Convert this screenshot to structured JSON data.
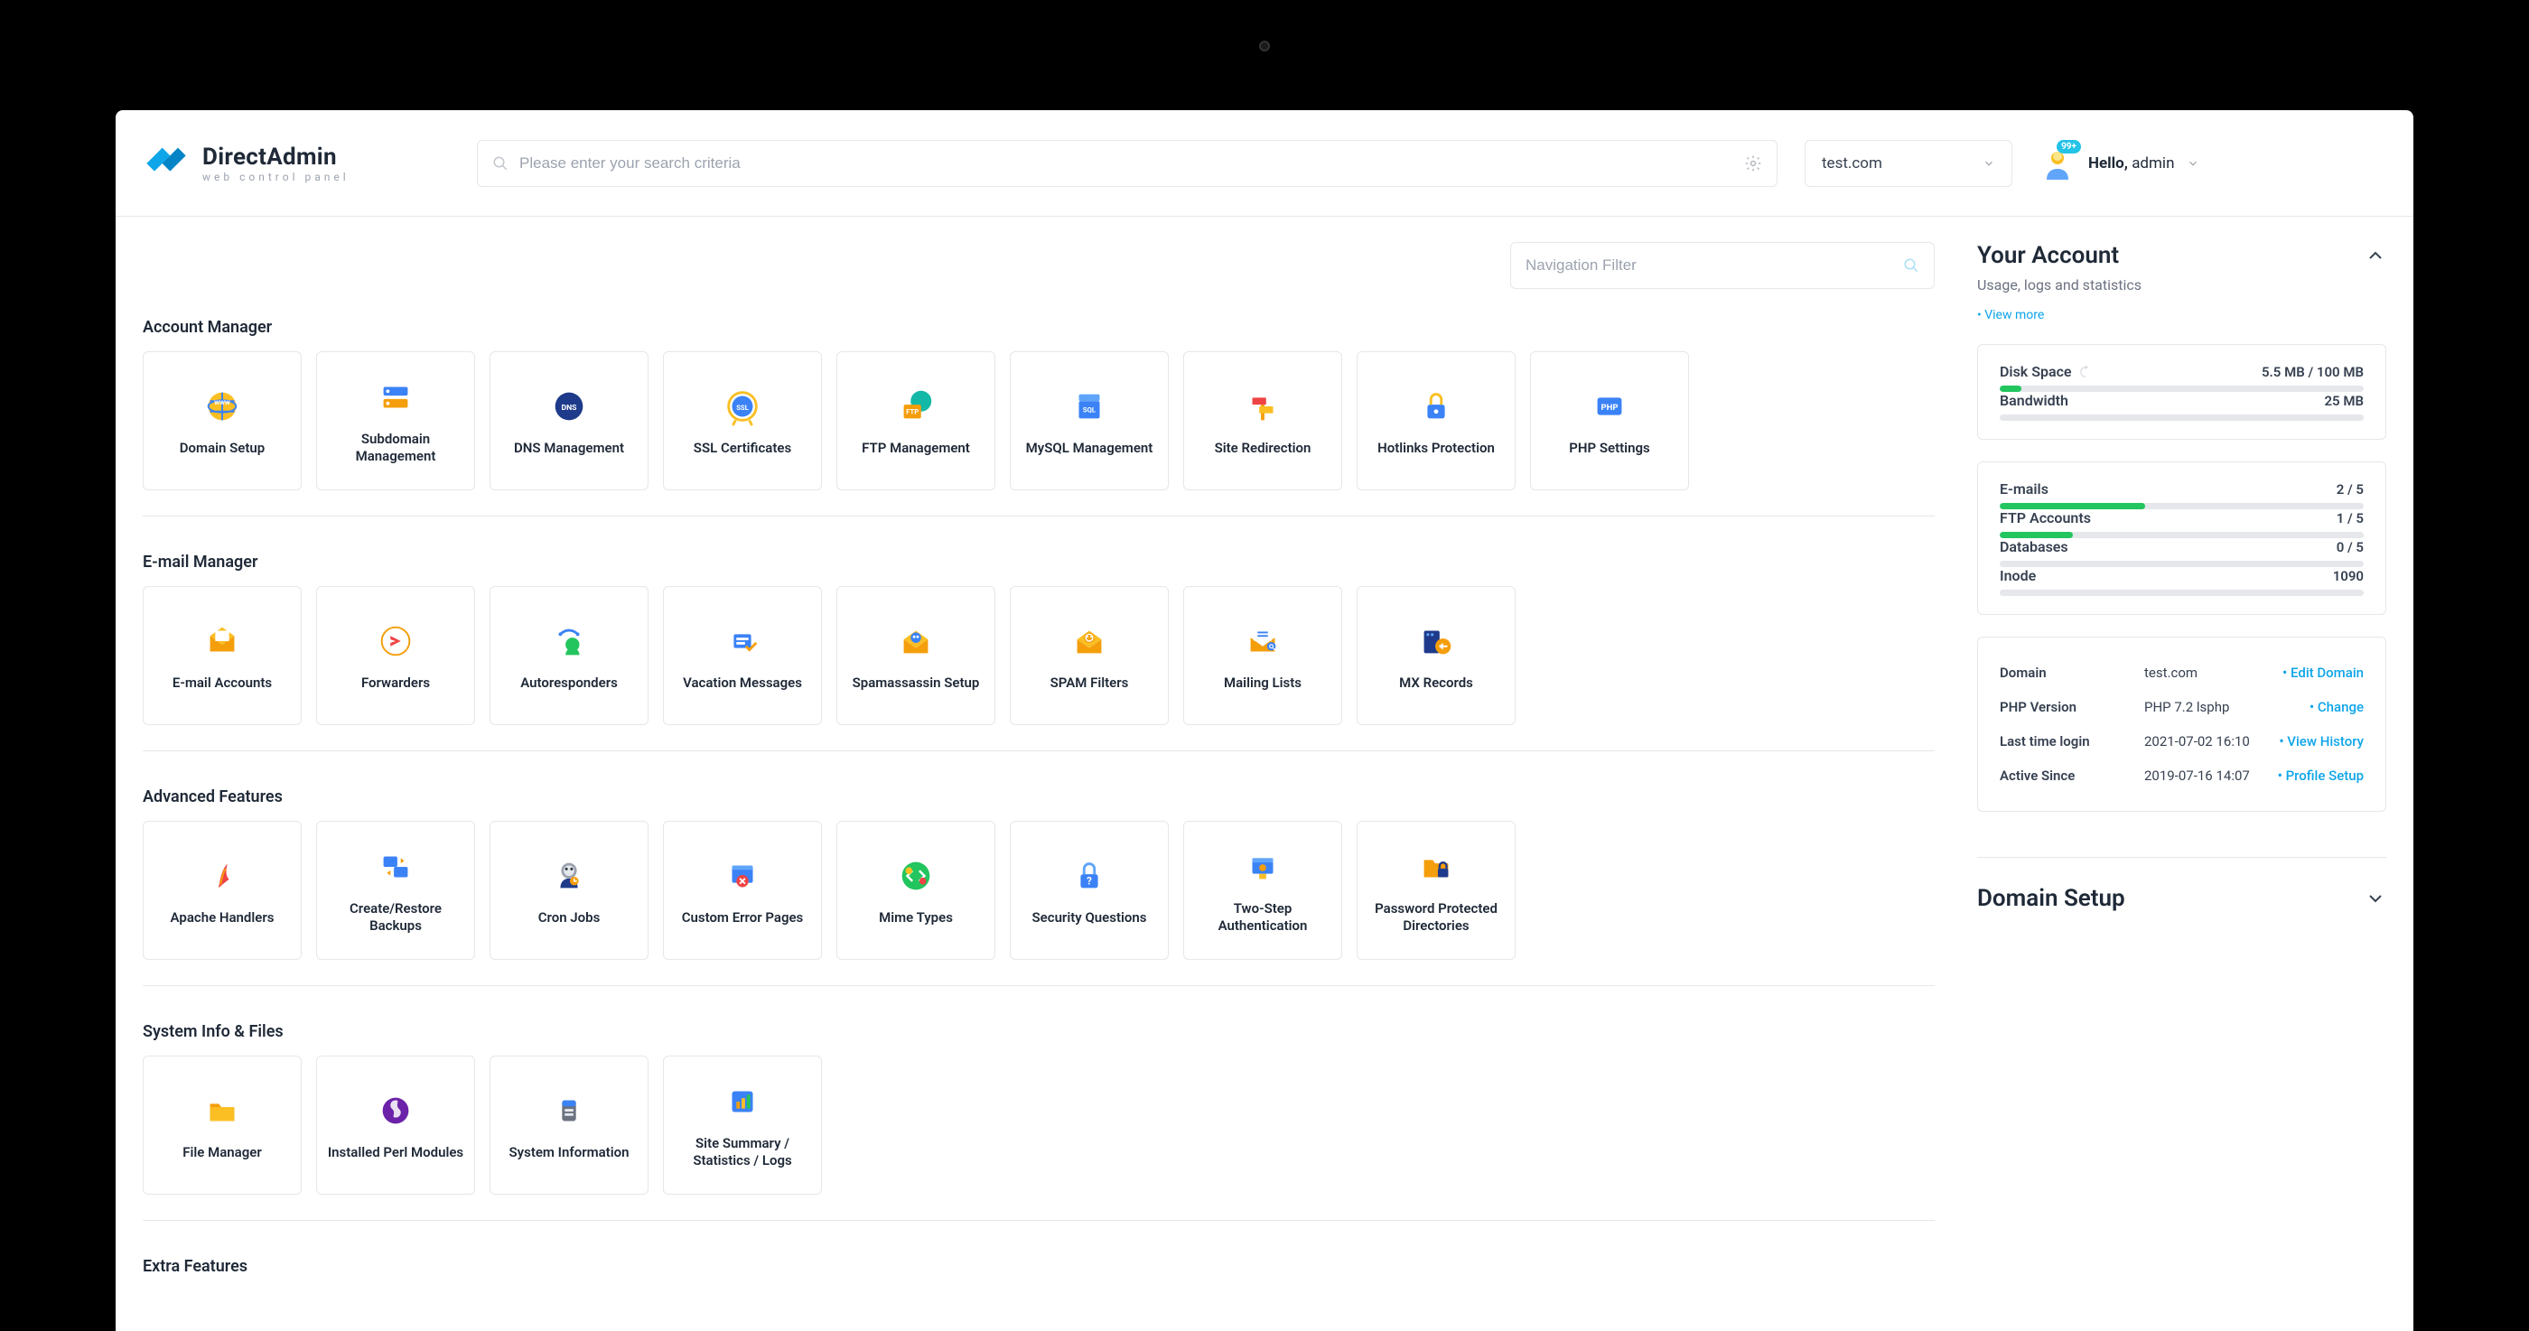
{
  "logo": {
    "title": "DirectAdmin",
    "subtitle": "web control panel"
  },
  "search": {
    "placeholder": "Please enter your search criteria"
  },
  "domain_dropdown": "test.com",
  "user": {
    "hello": "Hello,",
    "name": "admin",
    "badge": "99+"
  },
  "nav_filter": {
    "placeholder": "Navigation Filter"
  },
  "sections": [
    {
      "title": "Account Manager",
      "items": [
        {
          "icon": "globe",
          "label": "Domain Setup"
        },
        {
          "icon": "subdomain",
          "label": "Subdomain Management"
        },
        {
          "icon": "dns",
          "label": "DNS Management"
        },
        {
          "icon": "ssl",
          "label": "SSL Certificates"
        },
        {
          "icon": "ftp",
          "label": "FTP Management"
        },
        {
          "icon": "mysql",
          "label": "MySQL Management"
        },
        {
          "icon": "redirect",
          "label": "Site Redirection"
        },
        {
          "icon": "lock",
          "label": "Hotlinks Protection"
        },
        {
          "icon": "php",
          "label": "PHP Settings"
        }
      ]
    },
    {
      "title": "E-mail Manager",
      "items": [
        {
          "icon": "mail",
          "label": "E-mail Accounts"
        },
        {
          "icon": "forward",
          "label": "Forwarders"
        },
        {
          "icon": "autoresp",
          "label": "Autoresponders"
        },
        {
          "icon": "vacation",
          "label": "Vacation Messages"
        },
        {
          "icon": "spamassassin",
          "label": "Spamassassin Setup"
        },
        {
          "icon": "spam",
          "label": "SPAM Filters"
        },
        {
          "icon": "mailing",
          "label": "Mailing Lists"
        },
        {
          "icon": "mx",
          "label": "MX Records"
        }
      ]
    },
    {
      "title": "Advanced Features",
      "items": [
        {
          "icon": "apache",
          "label": "Apache Handlers"
        },
        {
          "icon": "backup",
          "label": "Create/Restore Backups"
        },
        {
          "icon": "cron",
          "label": "Cron Jobs"
        },
        {
          "icon": "errorpages",
          "label": "Custom Error Pages"
        },
        {
          "icon": "mime",
          "label": "Mime Types"
        },
        {
          "icon": "security",
          "label": "Security Questions"
        },
        {
          "icon": "twostep",
          "label": "Two-Step Authentication"
        },
        {
          "icon": "passdir",
          "label": "Password Protected Directories"
        }
      ]
    },
    {
      "title": "System Info & Files",
      "items": [
        {
          "icon": "folder",
          "label": "File Manager"
        },
        {
          "icon": "perl",
          "label": "Installed Perl Modules"
        },
        {
          "icon": "sysinfo",
          "label": "System Information"
        },
        {
          "icon": "stats",
          "label": "Site Summary / Statistics / Logs"
        }
      ]
    },
    {
      "title": "Extra Features",
      "items": []
    }
  ],
  "account": {
    "title": "Your Account",
    "subtitle": "Usage, logs and statistics",
    "view_more": "View more",
    "stats1": [
      {
        "label": "Disk Space",
        "refresh": true,
        "value": "5.5 MB / 100 MB",
        "pct": 6
      },
      {
        "label": "Bandwidth",
        "value": "25 MB",
        "pct": 0
      }
    ],
    "stats2": [
      {
        "label": "E-mails",
        "value": "2 / 5",
        "pct": 40
      },
      {
        "label": "FTP Accounts",
        "value": "1 / 5",
        "pct": 20
      },
      {
        "label": "Databases",
        "value": "0 / 5",
        "pct": 0
      },
      {
        "label": "Inode",
        "value": "1090",
        "pct": 0
      }
    ],
    "info": [
      {
        "label": "Domain",
        "value": "test.com",
        "link": "Edit Domain"
      },
      {
        "label": "PHP Version",
        "value": "PHP 7.2 lsphp",
        "link": "Change"
      },
      {
        "label": "Last time login",
        "value": "2021-07-02 16:10",
        "link": "View History"
      },
      {
        "label": "Active Since",
        "value": "2019-07-16 14:07",
        "link": "Profile Setup"
      }
    ]
  },
  "domain_setup_panel": {
    "title": "Domain Setup"
  }
}
